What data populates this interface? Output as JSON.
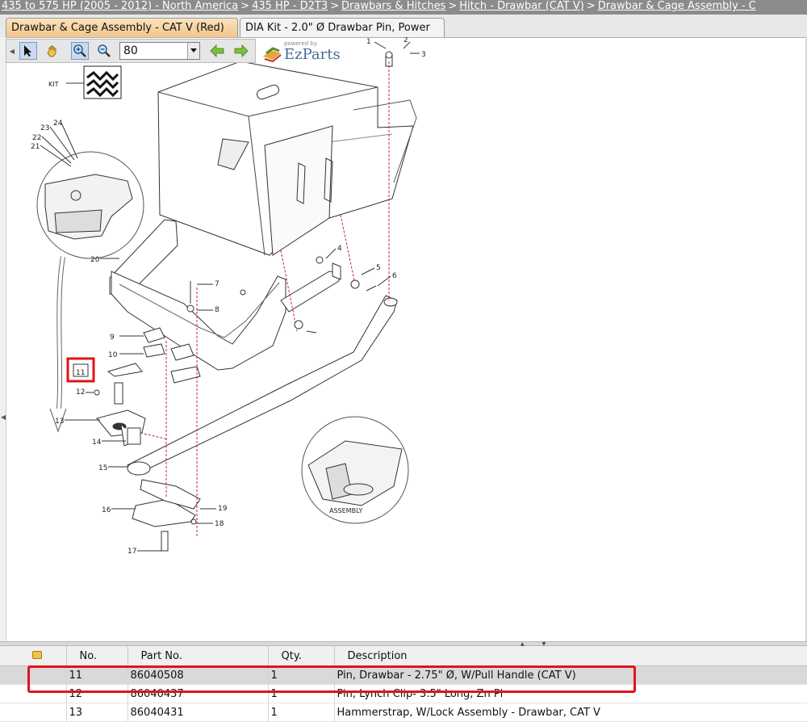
{
  "breadcrumb": {
    "items": [
      "435 to 575 HP (2005 - 2012) - North America",
      "435 HP - D2T3",
      "Drawbars & Hitches",
      "Hitch - Drawbar (CAT V)",
      "Drawbar & Cage Assembly - C"
    ],
    "separator": ">"
  },
  "tabs": [
    {
      "label": "Drawbar & Cage Assembly - CAT V (Red)",
      "active": true
    },
    {
      "label": "DIA Kit - 2.0\" Ø Drawbar Pin, Power",
      "active": false
    }
  ],
  "toolbar": {
    "tools": [
      "select-icon",
      "pan-hand-icon",
      "zoom-in-icon",
      "zoom-out-icon"
    ],
    "zoom_value": "80",
    "nav": [
      "back-arrow-icon",
      "forward-arrow-icon"
    ]
  },
  "logo": {
    "powered_by": "powered by",
    "brand": "EzParts"
  },
  "diagram": {
    "kit_label": "KIT",
    "assembly_label": "ASSEMBLY",
    "callouts": [
      "1",
      "2",
      "3",
      "4",
      "5",
      "6",
      "7",
      "8",
      "9",
      "10",
      "11",
      "12",
      "13",
      "14",
      "15",
      "16",
      "17",
      "18",
      "19",
      "20",
      "21",
      "22",
      "23",
      "24"
    ],
    "highlighted_callout": "11"
  },
  "table": {
    "headers": [
      "",
      "No.",
      "Part No.",
      "Qty.",
      "Description"
    ],
    "rows": [
      {
        "no": "11",
        "part": "86040508",
        "qty": "1",
        "desc": "Pin, Drawbar - 2.75\" Ø, W/Pull Handle (CAT V)",
        "selected": true
      },
      {
        "no": "12",
        "part": "86040437",
        "qty": "1",
        "desc": "Pin, Lynch Clip- 3.5\" Long, Zn Pl",
        "selected": false
      },
      {
        "no": "13",
        "part": "86040431",
        "qty": "1",
        "desc": "Hammerstrap, W/Lock Assembly - Drawbar, CAT V",
        "selected": false
      }
    ]
  },
  "colors": {
    "highlight": "#e0141a",
    "active_tab": "#f2c58b",
    "breadcrumb_bg": "#8b8b8b"
  }
}
